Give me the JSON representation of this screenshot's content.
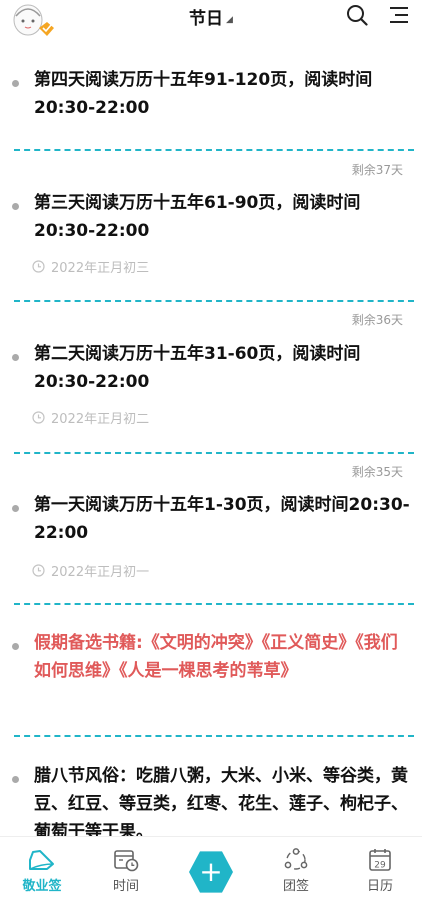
{
  "header": {
    "title": "节日",
    "search_icon": "search-icon",
    "menu_icon": "menu-icon"
  },
  "entries": [
    {
      "text": "第四天阅读万历十五年91-120页，阅读时间20:30-22:00",
      "date": "",
      "remaining": ""
    },
    {
      "text": "第三天阅读万历十五年61-90页，阅读时间20:30-22:00",
      "date": "2022年正月初三",
      "remaining": "剩余37天"
    },
    {
      "text": "第二天阅读万历十五年31-60页，阅读时间20:30-22:00",
      "date": "2022年正月初二",
      "remaining": "剩余36天"
    },
    {
      "text": "第一天阅读万历十五年1-30页，阅读时间20:30-22:00",
      "date": "2022年正月初一",
      "remaining": "剩余35天"
    },
    {
      "text": "假期备选书籍:《文明的冲突》《正义简史》《我们如何思维》《人是一棵思考的苇草》",
      "date": "",
      "remaining": ""
    },
    {
      "text": "腊八节风俗：吃腊八粥，大米、小米、等谷类，黄豆、红豆、等豆类，红枣、花生、莲子、枸杞子、葡萄干等干果。",
      "date": "",
      "remaining": ""
    }
  ],
  "tabbar": {
    "tabs": [
      {
        "label": "敬业签",
        "icon": "note-icon",
        "active": true
      },
      {
        "label": "时间",
        "icon": "calendar-clock-icon",
        "active": false
      },
      {
        "label": "+",
        "icon": "add-icon",
        "active": false
      },
      {
        "label": "团签",
        "icon": "team-icon",
        "active": false
      },
      {
        "label": "日历",
        "icon": "calendar-icon",
        "active": false
      }
    ],
    "calendar_day": "29"
  },
  "colors": {
    "accent": "#20b5c8",
    "highlight_text": "#e05a5a",
    "meta_text": "#bdbdbd"
  }
}
